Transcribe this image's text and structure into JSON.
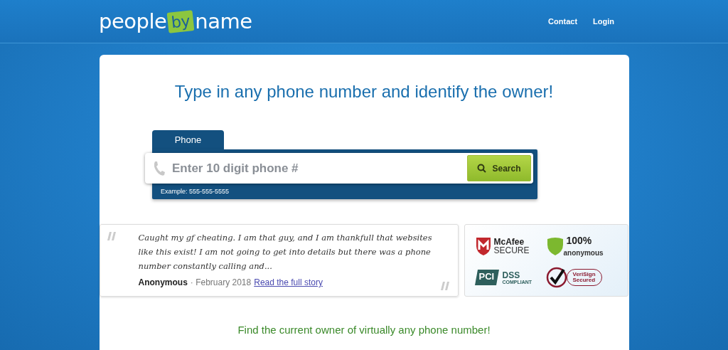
{
  "header": {
    "logo": {
      "left": "people",
      "badge": "by",
      "right": "name"
    },
    "nav": [
      "Contact",
      "Login"
    ]
  },
  "headline": "Type in any phone number and identify the owner!",
  "search": {
    "tabs": [
      {
        "label": "Phone",
        "selected": true
      }
    ],
    "placeholder": "Enter 10 digit phone #",
    "button": "Search",
    "example": "Example: 555-555-5555"
  },
  "testimonial": {
    "quote": "Caught my gf cheating. I am that guy, and I am thankfull that websites like this exist! I am not going to get into details but there was a phone number constantly calling and...",
    "author": "Anonymous",
    "date": "· February 2018",
    "link": "Read the full story"
  },
  "badges": {
    "mcafee": [
      "McAfee",
      "SECURE"
    ],
    "anonymous": [
      "100%",
      "anonymous"
    ],
    "pci": [
      "PCI",
      "DSS",
      "COMPLIANT"
    ],
    "verisign": [
      "VeriSign",
      "Secured"
    ]
  },
  "footer_text": "Find the current owner of virtually any phone number!"
}
